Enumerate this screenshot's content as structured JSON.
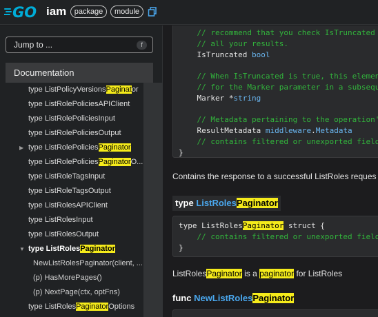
{
  "header": {
    "logo_text": "GO",
    "brand": "iam",
    "chip_package": "package",
    "chip_module": "module",
    "copy_icon": "copy-icon"
  },
  "sidebar": {
    "jump_label": "Jump to ...",
    "jump_shortcut": "f",
    "section_title": "Documentation",
    "items": [
      {
        "pre": "type ListPolicyVersions",
        "hl": "Paginat",
        "post": "or",
        "level": 1
      },
      {
        "pre": "type ListRolePoliciesAPIClient",
        "hl": "",
        "post": "",
        "level": 1
      },
      {
        "pre": "type ListRolePoliciesInput",
        "hl": "",
        "post": "",
        "level": 1
      },
      {
        "pre": "type ListRolePoliciesOutput",
        "hl": "",
        "post": "",
        "level": 1
      },
      {
        "pre": "type ListRolePolicies",
        "hl": "Paginator",
        "post": "",
        "level": 1,
        "caret": "right"
      },
      {
        "pre": "type ListRolePolicies",
        "hl": "Paginator",
        "post": "O...",
        "level": 1
      },
      {
        "pre": "type ListRoleTagsInput",
        "hl": "",
        "post": "",
        "level": 1
      },
      {
        "pre": "type ListRoleTagsOutput",
        "hl": "",
        "post": "",
        "level": 1
      },
      {
        "pre": "type ListRolesAPIClient",
        "hl": "",
        "post": "",
        "level": 1
      },
      {
        "pre": "type ListRolesInput",
        "hl": "",
        "post": "",
        "level": 1
      },
      {
        "pre": "type ListRolesOutput",
        "hl": "",
        "post": "",
        "level": 1
      },
      {
        "pre": "type ListRoles",
        "hl": "Paginator",
        "post": "",
        "level": 1,
        "caret": "down",
        "active": true
      },
      {
        "pre": "NewListRolesPaginator(client, ...",
        "hl": "",
        "post": "",
        "level": 2
      },
      {
        "pre": "(p) HasMorePages()",
        "hl": "",
        "post": "",
        "level": 2
      },
      {
        "pre": "(p) NextPage(ctx, optFns)",
        "hl": "",
        "post": "",
        "level": 2
      },
      {
        "pre": "type ListRoles",
        "hl": "Paginator",
        "post": "Options",
        "level": 1
      }
    ]
  },
  "main": {
    "code1": [
      {
        "cls": "cm",
        "text": "    // recommend that you check IsTruncated af"
      },
      {
        "cls": "cm",
        "text": "    // all your results."
      },
      {
        "cls": "mix",
        "ident": "    IsTruncated ",
        "type": "bool"
      },
      {
        "cls": "blank",
        "text": ""
      },
      {
        "cls": "cm",
        "text": "    // When IsTruncated is true, this element"
      },
      {
        "cls": "cm",
        "text": "    // for the Marker parameter in a subsequen"
      },
      {
        "cls": "mix",
        "ident": "    Marker *",
        "type": "string"
      },
      {
        "cls": "blank",
        "text": ""
      },
      {
        "cls": "cm",
        "text": "    // Metadata pertaining to the operation's"
      },
      {
        "cls": "mix2",
        "ident": "    ResultMetadata ",
        "type": "middleware",
        "dot": ".",
        "type2": "Metadata"
      },
      {
        "cls": "cm",
        "text": "    // contains filtered or unexported fields"
      },
      {
        "cls": "plain",
        "text": "}"
      }
    ],
    "para1": "Contains the response to a successful ListRoles reques",
    "decl": {
      "kw": "type ",
      "link": "ListRoles",
      "hl": "Paginator"
    },
    "code2": {
      "line1_pre": "type ListRoles",
      "line1_hl": "Paginator",
      "line1_post": " struct {",
      "line2": "    // contains filtered or unexported fields",
      "line3": "}"
    },
    "para2": {
      "a": "ListRoles",
      "b": "Paginator",
      "c": " is a ",
      "d": "paginator",
      "e": " for ListRoles"
    },
    "func": {
      "kw": "func ",
      "link": "NewListRoles",
      "hl": "Paginator"
    }
  }
}
